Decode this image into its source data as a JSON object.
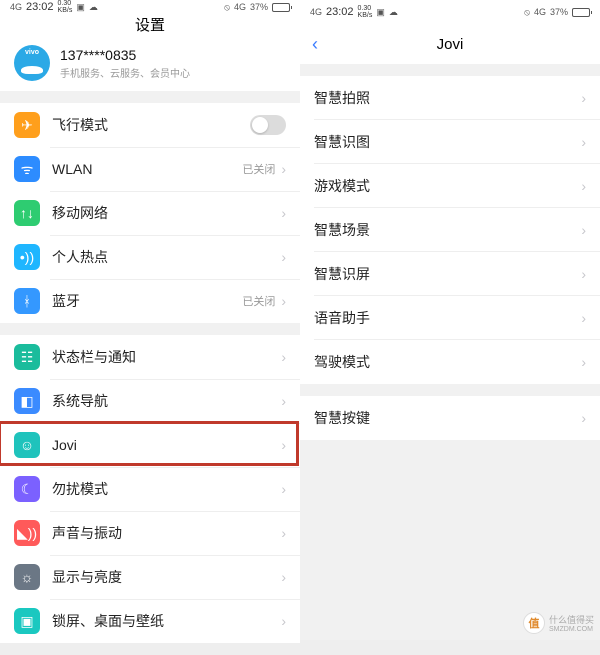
{
  "statusbar": {
    "time": "23:02",
    "net_rate_top": "0.30",
    "net_rate_unit": "KB/s",
    "signal_tag": "4G",
    "battery_pct": "37%"
  },
  "left": {
    "title": "设置",
    "account": {
      "phone": "137****0835",
      "sub": "手机服务、云服务、会员中心"
    },
    "groups": [
      {
        "rows": [
          {
            "name": "airplane",
            "icon_bg": "ic-orange",
            "glyph": "✈",
            "label": "飞行模式",
            "type": "toggle"
          },
          {
            "name": "wlan",
            "icon_bg": "ic-blue",
            "glyph": "ᯤ",
            "label": "WLAN",
            "type": "nav",
            "status": "已关闭"
          },
          {
            "name": "mobile-net",
            "icon_bg": "ic-green",
            "glyph": "↑↓",
            "label": "移动网络",
            "type": "nav"
          },
          {
            "name": "hotspot",
            "icon_bg": "ic-skblue",
            "glyph": "•))",
            "label": "个人热点",
            "type": "nav"
          },
          {
            "name": "bluetooth",
            "icon_bg": "ic-bt",
            "glyph": "ᚼ",
            "label": "蓝牙",
            "type": "nav",
            "status": "已关闭"
          }
        ]
      },
      {
        "rows": [
          {
            "name": "status-notif",
            "icon_bg": "ic-teal",
            "glyph": "☷",
            "label": "状态栏与通知",
            "type": "nav"
          },
          {
            "name": "sys-nav",
            "icon_bg": "ic-nav",
            "glyph": "◧",
            "label": "系统导航",
            "type": "nav"
          },
          {
            "name": "jovi",
            "icon_bg": "ic-jovi",
            "glyph": "☺",
            "label": "Jovi",
            "type": "nav",
            "highlight": true
          },
          {
            "name": "dnd",
            "icon_bg": "ic-moon",
            "glyph": "☾",
            "label": "勿扰模式",
            "type": "nav"
          },
          {
            "name": "sound",
            "icon_bg": "ic-red",
            "glyph": "◣))",
            "label": "声音与振动",
            "type": "nav"
          },
          {
            "name": "display",
            "icon_bg": "ic-grey",
            "glyph": "☼",
            "label": "显示与亮度",
            "type": "nav"
          },
          {
            "name": "lockscreen",
            "icon_bg": "ic-cyan",
            "glyph": "▣",
            "label": "锁屏、桌面与壁纸",
            "type": "nav"
          }
        ]
      }
    ]
  },
  "right": {
    "title": "Jovi",
    "groups": [
      [
        "智慧拍照",
        "智慧识图",
        "游戏模式",
        "智慧场景",
        "智慧识屏",
        "语音助手",
        "驾驶模式"
      ],
      [
        "智慧按键"
      ]
    ]
  },
  "watermark": {
    "badge": "值",
    "text": "什么值得买",
    "site": "SMZDM.COM"
  }
}
